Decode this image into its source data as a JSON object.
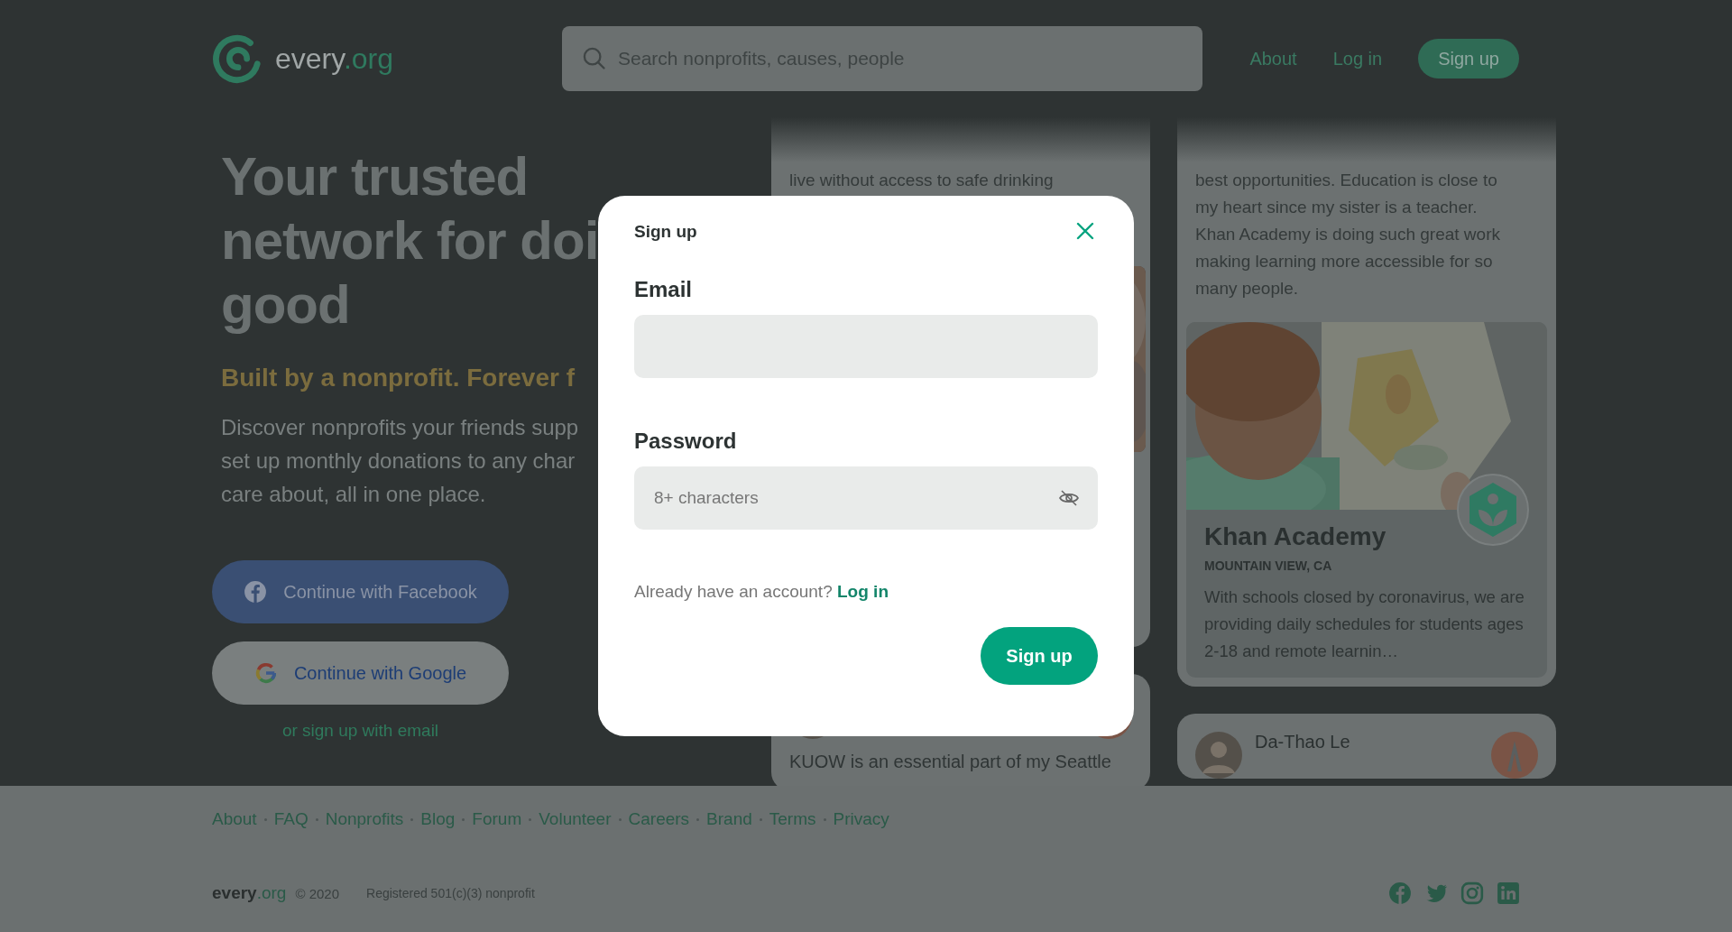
{
  "header": {
    "logo": {
      "name": "every",
      "suffix": ".org"
    },
    "search": {
      "placeholder": "Search nonprofits, causes, people"
    },
    "nav": [
      {
        "label": "About",
        "kind": "link"
      },
      {
        "label": "Log in",
        "kind": "link"
      },
      {
        "label": "Sign up",
        "kind": "button"
      }
    ]
  },
  "hero": {
    "heading_lines": [
      "Your trusted",
      "network for doi",
      "good"
    ],
    "tagline": "Built by a nonprofit. Forever f",
    "description_lines": [
      "Discover nonprofits your friends supp",
      "set up monthly donations to any char",
      "care about, all in one place."
    ],
    "buttons": [
      {
        "label": "Continue with Facebook",
        "kind": "facebook"
      },
      {
        "label": "Continue with Google",
        "kind": "google"
      }
    ],
    "email_link": "or sign up with email"
  },
  "feed": [
    {
      "cards": [
        {
          "kind": "quote",
          "text": "live without access to safe drinking",
          "picture": true
        },
        {
          "kind": "post",
          "text": "KUOW is an essential part of my Seattle"
        }
      ]
    },
    {
      "cards": [
        {
          "kind": "quote",
          "text": "best opportunities. Education is close to my heart since my sister is a teacher. Khan Academy is doing such great work making learning more accessible for so many people.",
          "nonprofit": {
            "name": "Khan Academy",
            "location": "MOUNTAIN VIEW, CA",
            "description": "With schools closed by coronavirus, we are providing daily schedules for students ages 2-18 and remote learnin…"
          }
        },
        {
          "kind": "post",
          "author": "Da-Thao Le"
        }
      ]
    }
  ],
  "footer": {
    "links": [
      "About",
      "FAQ",
      "Nonprofits",
      "Blog",
      "Forum",
      "Volunteer",
      "Careers",
      "Brand",
      "Terms",
      "Privacy"
    ],
    "brand": {
      "name": "every",
      "suffix": ".org"
    },
    "copyright": "© 2020",
    "registration": "Registered 501(c)(3) nonprofit"
  },
  "modal": {
    "title": "Sign up",
    "fields": [
      {
        "label": "Email",
        "kind": "email"
      },
      {
        "label": "Password",
        "kind": "password",
        "placeholder": "8+ characters"
      }
    ],
    "prompt": "Already have an account?",
    "prompt_link": "Log in",
    "submit": "Sign up"
  }
}
